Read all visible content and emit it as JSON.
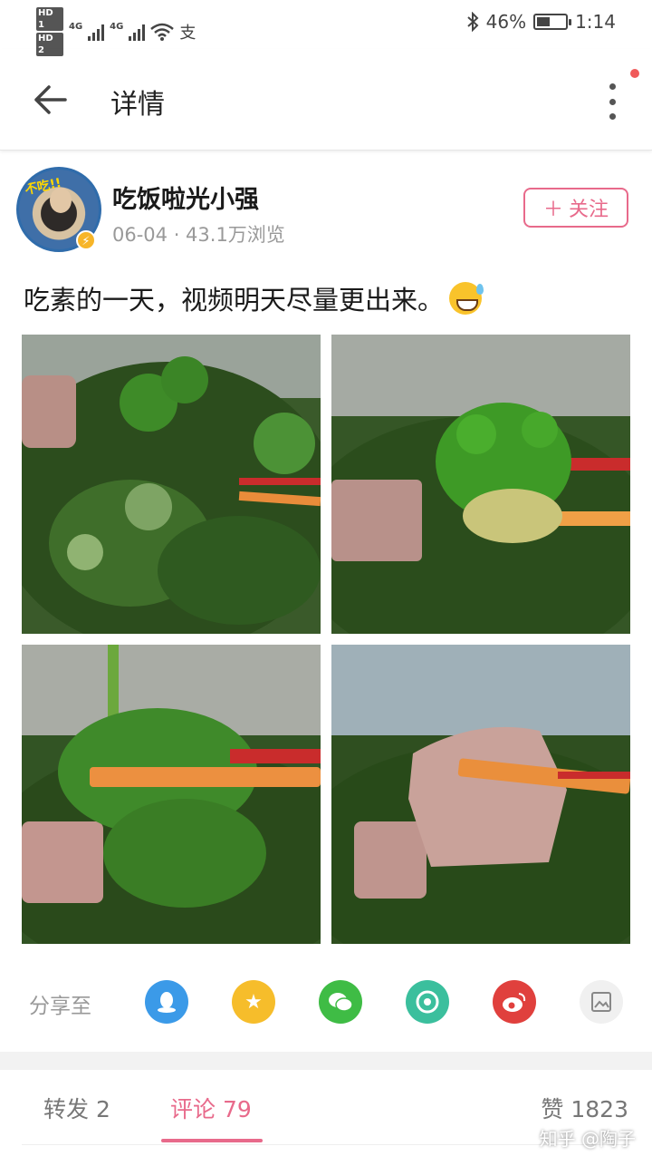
{
  "status_bar": {
    "hd1": "HD 1",
    "hd2": "HD 2",
    "net1": "4G",
    "net2": "4G",
    "battery": "46%",
    "battery_level": 0.46,
    "time": "1:14"
  },
  "header": {
    "title": "详情"
  },
  "author": {
    "name": "吃饭啦光小强",
    "meta": "06-04 · 43.1万浏览",
    "avatar_text": "不吃!!",
    "follow_label": "关注"
  },
  "post": {
    "text": "吃素的一天，视频明天尽量更出来。"
  },
  "share": {
    "label": "分享至",
    "targets": [
      "qq-icon",
      "qzone-icon",
      "wechat-icon",
      "moments-icon",
      "weibo-icon",
      "save-image-icon"
    ]
  },
  "tabs": {
    "repost": "转发 2",
    "comments": "评论 79",
    "likes": "赞 1823"
  },
  "watermark": "知乎 @陶子",
  "colors": {
    "accent": "#e86a8b",
    "qq": "#3b9ae8",
    "qzone": "#f6bd2b",
    "wechat": "#3fbc45",
    "moments": "#3bbf9d",
    "weibo": "#e0403d"
  }
}
